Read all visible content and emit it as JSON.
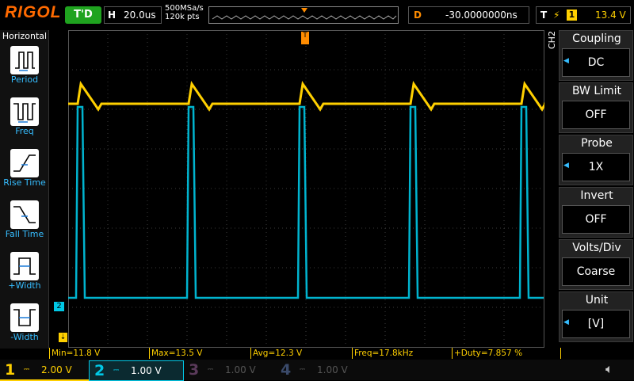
{
  "top": {
    "brand": "RIGOL",
    "run_state": "T'D",
    "horizontal_label": "H",
    "timebase": "20.0us",
    "sample_rate": "500MSa/s",
    "memory_depth": "120k pts",
    "delay_label": "D",
    "delay_value": "-30.0000000ns",
    "trigger_label": "T",
    "trigger_source": "1",
    "trigger_level": "13.4 V"
  },
  "left_menu": {
    "title": "Horizontal",
    "items": [
      {
        "label": "Period"
      },
      {
        "label": "Freq"
      },
      {
        "label": "Rise Time"
      },
      {
        "label": "Fall Time"
      },
      {
        "label": "+Width"
      },
      {
        "label": "-Width"
      }
    ]
  },
  "right_menu": {
    "channel_tag": "CH2",
    "items": [
      {
        "title": "Coupling",
        "value": "DC"
      },
      {
        "title": "BW Limit",
        "value": "OFF"
      },
      {
        "title": "Probe",
        "value": "1X"
      },
      {
        "title": "Invert",
        "value": "OFF"
      },
      {
        "title": "Volts/Div",
        "value": "Coarse"
      },
      {
        "title": "Unit",
        "value": "[V]"
      }
    ]
  },
  "measurements": [
    "Min=11.8 V",
    "Max=13.5 V",
    "Avg=12.3 V",
    "Freq=17.8kHz",
    "+Duty=7.857 %"
  ],
  "channels": [
    {
      "num": "1",
      "scale": "2.00 V",
      "color": "#ffd000"
    },
    {
      "num": "2",
      "scale": "1.00 V",
      "color": "#00c8e6"
    },
    {
      "num": "3",
      "scale": "1.00 V",
      "color": "#c000c8"
    },
    {
      "num": "4",
      "scale": "1.00 V",
      "color": "#3a6cff"
    }
  ],
  "markers": {
    "ch2_ground": "2",
    "trigger_pos": "T"
  },
  "colors": {
    "ch1": "#ffd000",
    "ch2": "#00c8e6",
    "accent": "#ff6a00",
    "menu_highlight": "#36bdff"
  }
}
